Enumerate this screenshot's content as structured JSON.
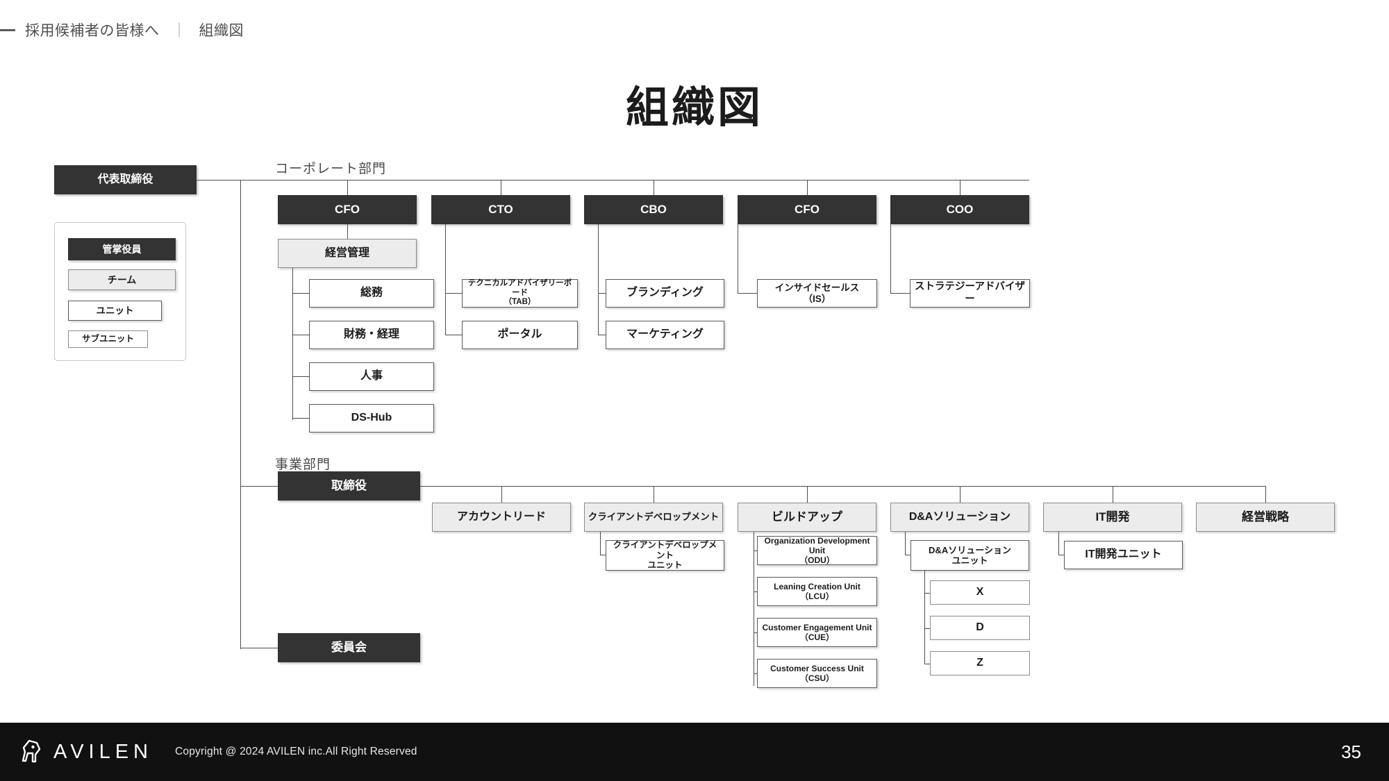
{
  "header": {
    "breadcrumb_primary": "採用候補者の皆様へ",
    "separator": "｜",
    "breadcrumb_secondary": "組織図"
  },
  "page_title": "組織図",
  "legend": {
    "root_label": "代表取締役",
    "items": [
      {
        "label": "管掌役員",
        "style": "executive"
      },
      {
        "label": "チーム",
        "style": "team"
      },
      {
        "label": "ユニット",
        "style": "unit"
      },
      {
        "label": "サブユニット",
        "style": "subunit"
      }
    ]
  },
  "sections": {
    "corporate": {
      "caption": "コーポレート部門",
      "executives": [
        {
          "label": "CFO",
          "children": [
            {
              "label": "経営管理",
              "style": "team",
              "children": [
                {
                  "label": "総務",
                  "style": "unit"
                },
                {
                  "label": "財務・経理",
                  "style": "unit"
                },
                {
                  "label": "人事",
                  "style": "unit"
                },
                {
                  "label": "DS-Hub",
                  "style": "unit"
                }
              ]
            }
          ]
        },
        {
          "label": "CTO",
          "children": [
            {
              "label": "テクニカルアドバイザリーボード\n（TAB）",
              "style": "unit"
            },
            {
              "label": "ポータル",
              "style": "unit"
            }
          ]
        },
        {
          "label": "CBO",
          "children": [
            {
              "label": "ブランディング",
              "style": "unit"
            },
            {
              "label": "マーケティング",
              "style": "unit"
            }
          ]
        },
        {
          "label": "CFO",
          "children": [
            {
              "label": "インサイドセールス\n（IS）",
              "style": "unit"
            }
          ]
        },
        {
          "label": "COO",
          "children": [
            {
              "label": "ストラテジーアドバイザー",
              "style": "unit"
            }
          ]
        }
      ]
    },
    "business": {
      "caption": "事業部門",
      "executive": "取締役",
      "committee": "委員会",
      "teams": [
        {
          "label": "アカウントリード",
          "children": []
        },
        {
          "label": "クライアントデベロップメント",
          "children": [
            {
              "label": "クライアントデベロップメント\nユニット",
              "style": "unit",
              "children": []
            }
          ]
        },
        {
          "label": "ビルドアップ",
          "children": [
            {
              "label": "Organization Development Unit\n（ODU）",
              "style": "unit",
              "children": []
            },
            {
              "label": "Leaning Creation Unit\n（LCU）",
              "style": "unit",
              "children": []
            },
            {
              "label": "Customer Engagement Unit\n（CUE）",
              "style": "unit",
              "children": []
            },
            {
              "label": "Customer Success Unit\n（CSU）",
              "style": "unit",
              "children": []
            }
          ]
        },
        {
          "label": "D&Aソリューション",
          "children": [
            {
              "label": "D&Aソリューション\nユニット",
              "style": "unit",
              "children": [
                {
                  "label": "X",
                  "style": "subunit"
                },
                {
                  "label": "D",
                  "style": "subunit"
                },
                {
                  "label": "Z",
                  "style": "subunit"
                }
              ]
            }
          ]
        },
        {
          "label": "IT開発",
          "children": [
            {
              "label": "IT開発ユニット",
              "style": "unit",
              "children": []
            }
          ]
        },
        {
          "label": "経営戦略",
          "children": []
        }
      ]
    }
  },
  "footer": {
    "logo_text": "AVILEN",
    "copyright": "Copyright @ 2024 AVILEN inc.All Right Reserved",
    "page_number": "35"
  },
  "colors": {
    "executive_fill": "#333333",
    "team_fill": "#ececec",
    "unit_fill": "#ffffff",
    "line": "#4d4d4d",
    "footer_bg": "#111111"
  }
}
